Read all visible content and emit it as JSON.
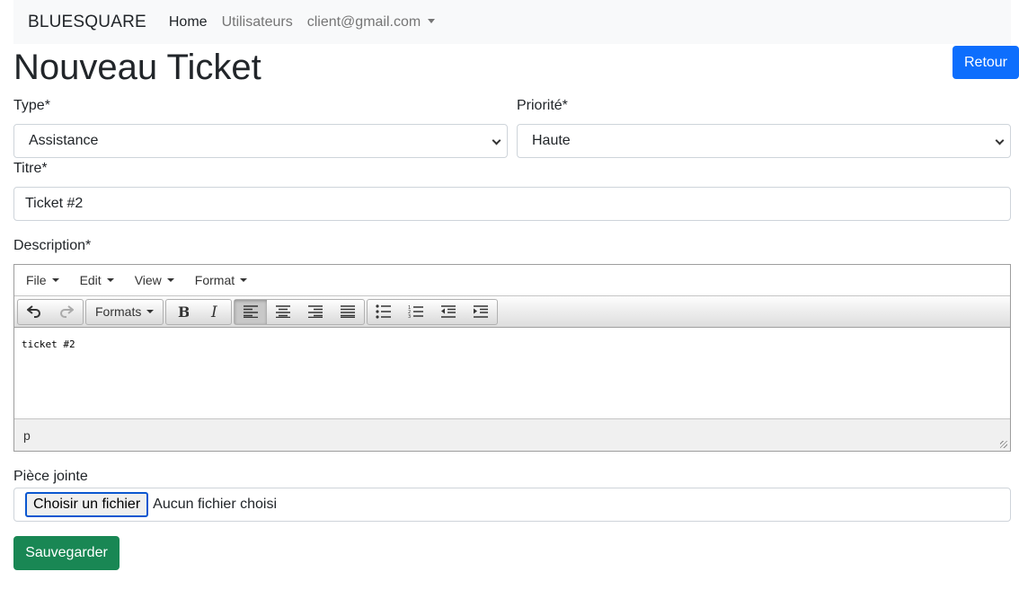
{
  "navbar": {
    "brand": "BLUESQUARE",
    "links": [
      "Home",
      "Utilisateurs"
    ],
    "user_menu": "client@gmail.com"
  },
  "page": {
    "title": "Nouveau Ticket",
    "back_label": "Retour"
  },
  "form": {
    "type_label": "Type*",
    "type_value": "Assistance",
    "priority_label": "Priorité*",
    "priority_value": "Haute",
    "title_label": "Titre*",
    "title_value": "Ticket #2",
    "description_label": "Description*",
    "attachment_label": "Pièce jointe",
    "file_button_label": "Choisir un fichier",
    "file_status": "Aucun fichier choisi",
    "save_label": "Sauvegarder"
  },
  "editor": {
    "menus": [
      "File",
      "Edit",
      "View",
      "Format"
    ],
    "formats_label": "Formats",
    "content": "ticket #2",
    "status_path": "p"
  },
  "colors": {
    "primary": "#0d6efd",
    "success": "#198754",
    "navbar_bg": "#f8f9fa"
  }
}
